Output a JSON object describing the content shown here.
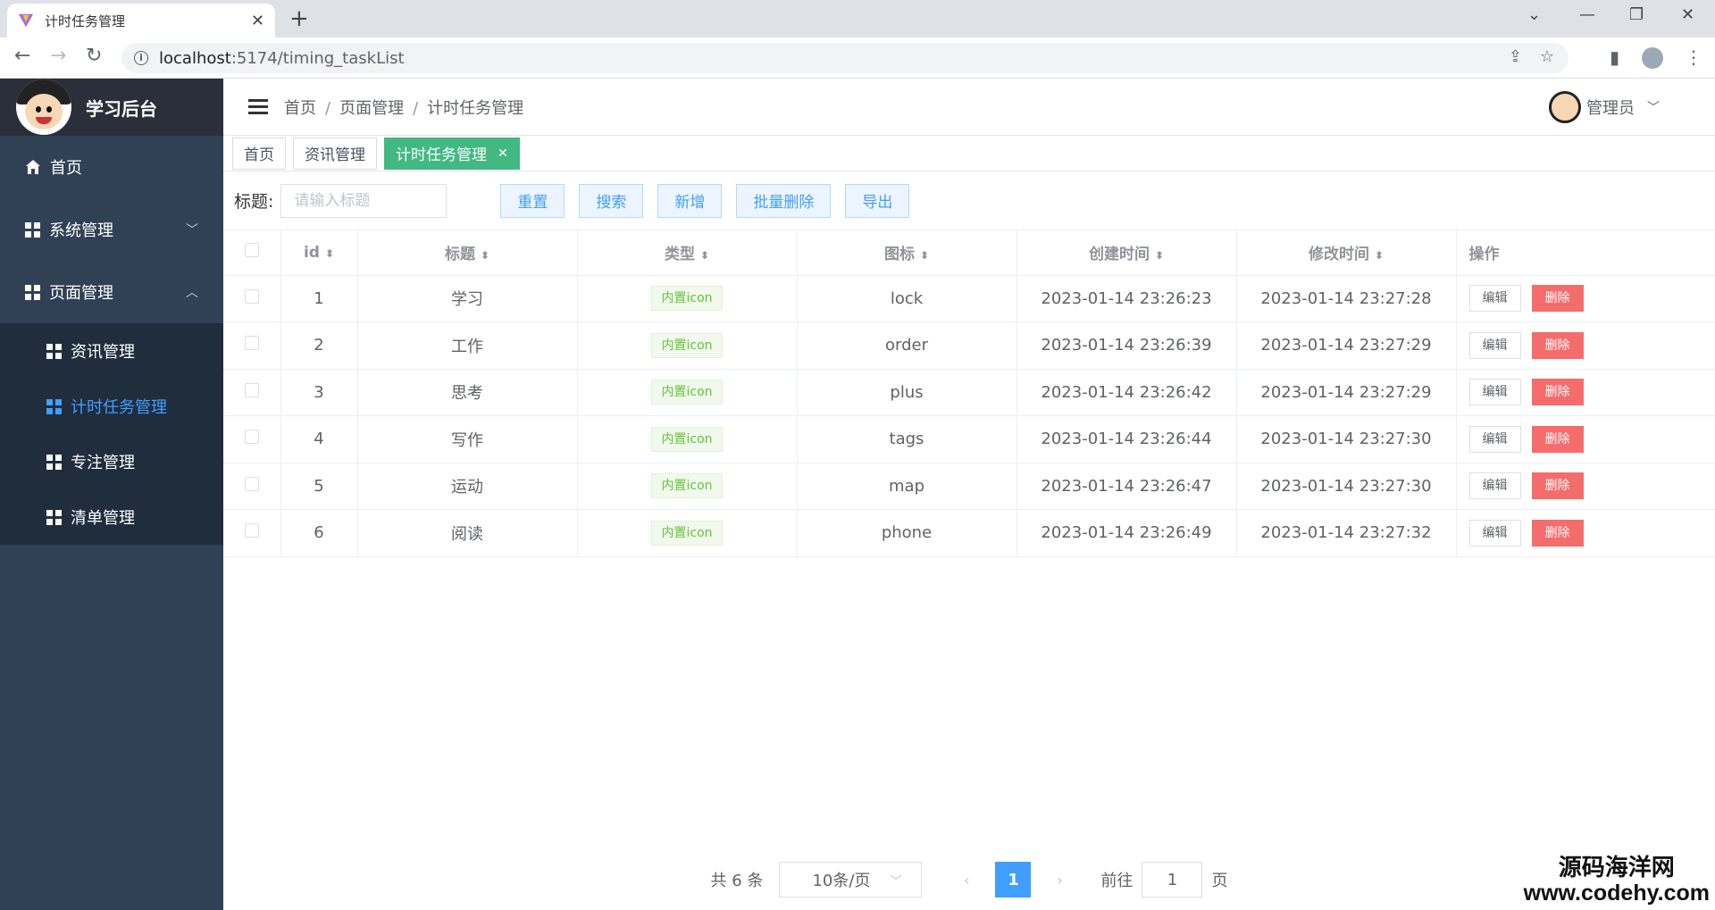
{
  "browser": {
    "tab_title": "计时任务管理",
    "url_host": "localhost",
    "url_path": ":5174/timing_taskList"
  },
  "sidebar": {
    "app_name": "学习后台",
    "items": [
      {
        "label": "首页"
      },
      {
        "label": "系统管理"
      },
      {
        "label": "页面管理"
      }
    ],
    "subitems": [
      {
        "label": "资讯管理"
      },
      {
        "label": "计时任务管理"
      },
      {
        "label": "专注管理"
      },
      {
        "label": "清单管理"
      }
    ]
  },
  "header": {
    "breadcrumb": [
      "首页",
      "页面管理",
      "计时任务管理"
    ],
    "user": "管理员"
  },
  "tags": [
    "首页",
    "资讯管理",
    "计时任务管理"
  ],
  "toolbar": {
    "title_label": "标题:",
    "title_placeholder": "请输入标题",
    "buttons": [
      "重置",
      "搜索",
      "新增",
      "批量删除",
      "导出"
    ]
  },
  "table": {
    "columns": [
      "id",
      "标题",
      "类型",
      "图标",
      "创建时间",
      "修改时间",
      "操作"
    ],
    "rows": [
      {
        "id": "1",
        "title": "学习",
        "type": "内置icon",
        "icon": "lock",
        "created": "2023-01-14 23:26:23",
        "modified": "2023-01-14 23:27:28"
      },
      {
        "id": "2",
        "title": "工作",
        "type": "内置icon",
        "icon": "order",
        "created": "2023-01-14 23:26:39",
        "modified": "2023-01-14 23:27:29"
      },
      {
        "id": "3",
        "title": "思考",
        "type": "内置icon",
        "icon": "plus",
        "created": "2023-01-14 23:26:42",
        "modified": "2023-01-14 23:27:29"
      },
      {
        "id": "4",
        "title": "写作",
        "type": "内置icon",
        "icon": "tags",
        "created": "2023-01-14 23:26:44",
        "modified": "2023-01-14 23:27:30"
      },
      {
        "id": "5",
        "title": "运动",
        "type": "内置icon",
        "icon": "map",
        "created": "2023-01-14 23:26:47",
        "modified": "2023-01-14 23:27:30"
      },
      {
        "id": "6",
        "title": "阅读",
        "type": "内置icon",
        "icon": "phone",
        "created": "2023-01-14 23:26:49",
        "modified": "2023-01-14 23:27:32"
      }
    ],
    "edit_label": "编辑",
    "delete_label": "删除"
  },
  "pagination": {
    "total": "共 6 条",
    "page_size": "10条/页",
    "current": "1",
    "goto_label": "前往",
    "goto_value": "1",
    "page_suffix": "页"
  },
  "watermark": {
    "cn": "源码海洋网",
    "en": "www.codehy.com"
  },
  "colors": {
    "sidebar_bg": "#304156",
    "active_menu": "#409eff",
    "active_tag": "#42b983",
    "delete": "#f56c6c"
  }
}
